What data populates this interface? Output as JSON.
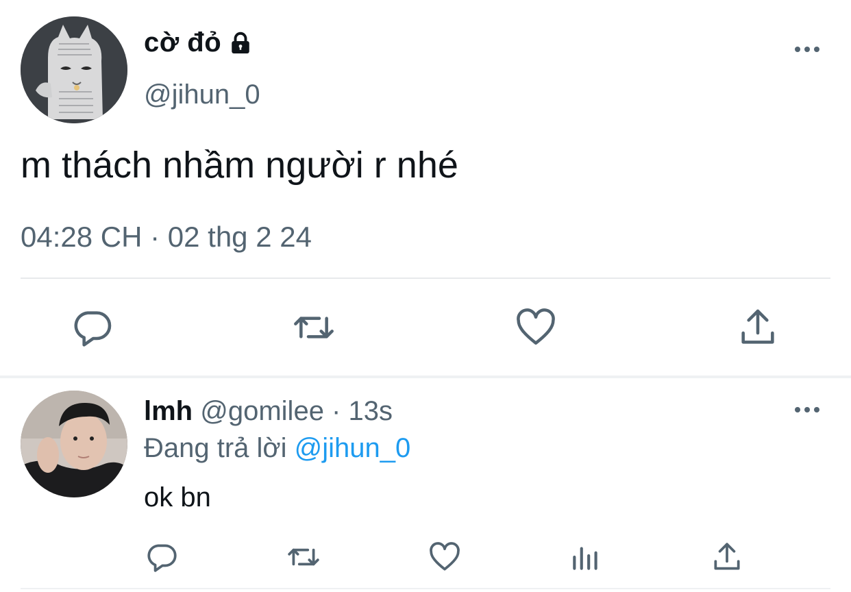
{
  "tweet": {
    "display_name": "cờ đỏ",
    "handle": "@jihun_0",
    "text": "m thách nhầm người r nhé",
    "timestamp": "04:28 CH · 02 thg 2 24",
    "avatar_icon": "cat-illustration-avatar",
    "locked_icon": "lock-icon"
  },
  "reply": {
    "display_name": "lmh",
    "meta": "@gomilee · 13s",
    "replying_to_prefix": "Đang trả lời",
    "replying_to_handle": "@jihun_0",
    "text": "ok bn",
    "avatar_icon": "user-photo-avatar"
  },
  "colors": {
    "text_primary": "#0f1419",
    "text_secondary": "#536471",
    "link": "#1d9bf0",
    "divider": "#e7e9eb"
  }
}
